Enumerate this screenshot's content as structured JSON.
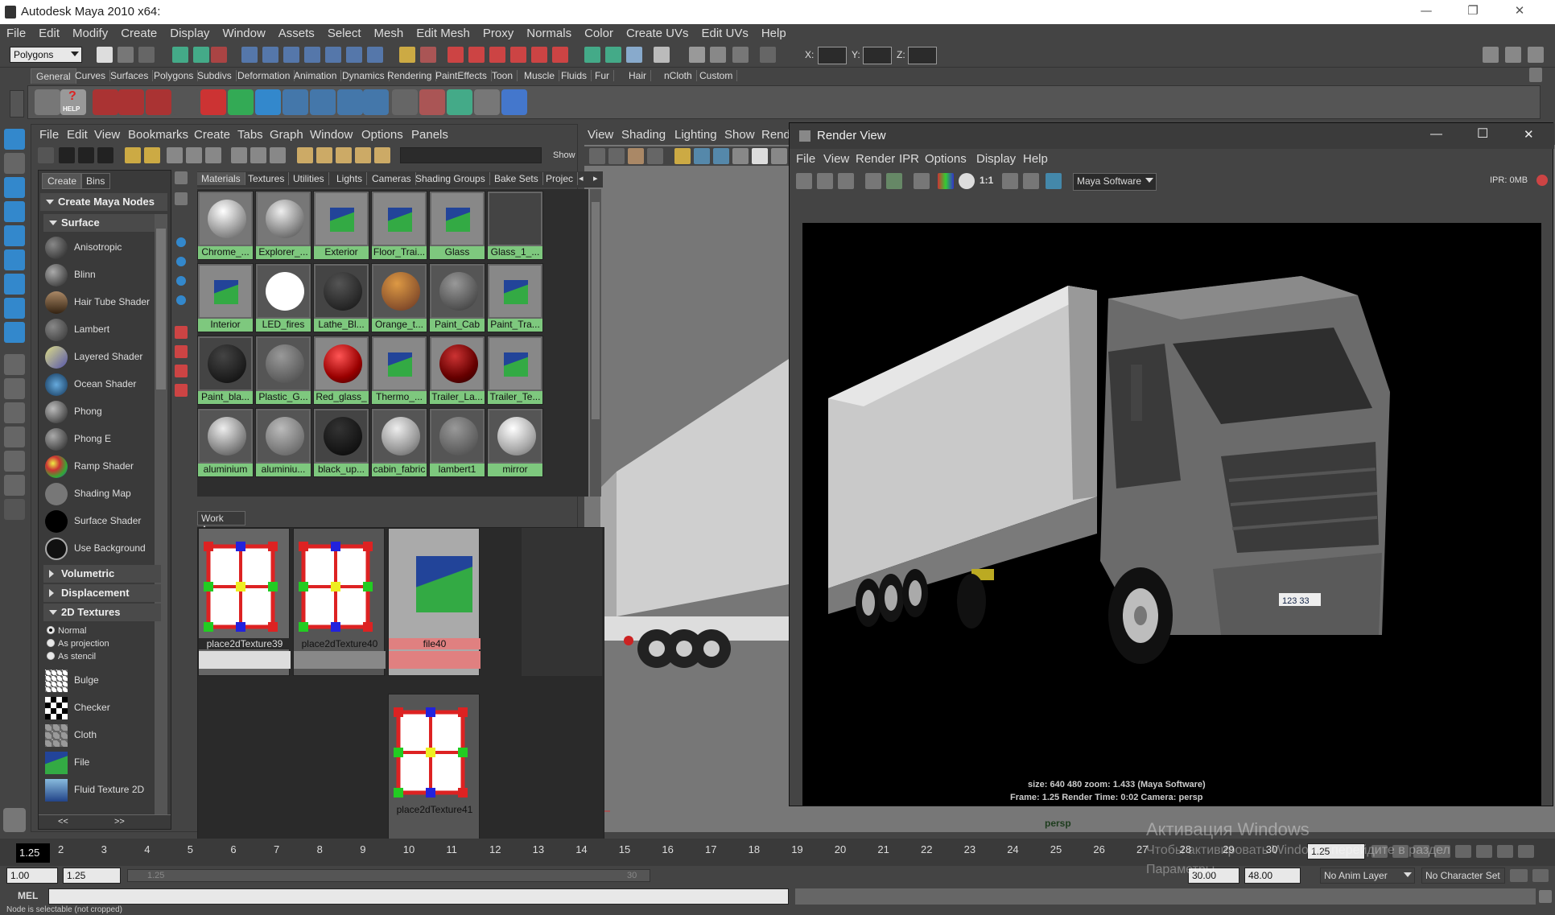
{
  "window": {
    "title": "Autodesk Maya 2010 x64:"
  },
  "menubar": [
    "File",
    "Edit",
    "Modify",
    "Create",
    "Display",
    "Window",
    "Assets",
    "Select",
    "Mesh",
    "Edit Mesh",
    "Proxy",
    "Normals",
    "Color",
    "Create UVs",
    "Edit UVs",
    "Help"
  ],
  "status": {
    "mode": "Polygons",
    "x_label": "X:",
    "y_label": "Y:",
    "z_label": "Z:"
  },
  "shelf_tabs": [
    "General",
    "Curves",
    "Surfaces",
    "Polygons",
    "Subdivs",
    "Deformation",
    "Animation",
    "Dynamics",
    "Rendering",
    "PaintEffects",
    "Toon",
    "Muscle",
    "Fluids",
    "Fur",
    "Hair",
    "nCloth",
    "Custom"
  ],
  "shelf": {
    "help_label": "HELP"
  },
  "hypershade": {
    "menu": [
      "File",
      "Edit",
      "View",
      "Bookmarks",
      "Create",
      "Tabs",
      "Graph",
      "Window",
      "Options",
      "Panels"
    ],
    "show_label": "Show",
    "left_tabs": [
      "Create",
      "Bins"
    ],
    "create_header": "Create Maya Nodes",
    "surface_header": "Surface",
    "surface_nodes": [
      "Anisotropic",
      "Blinn",
      "Hair Tube Shader",
      "Lambert",
      "Layered Shader",
      "Ocean Shader",
      "Phong",
      "Phong E",
      "Ramp Shader",
      "Shading Map",
      "Surface Shader",
      "Use Background"
    ],
    "volumetric_header": "Volumetric",
    "displacement_header": "Displacement",
    "textures2d_header": "2D Textures",
    "tex_modes": [
      "Normal",
      "As projection",
      "As stencil"
    ],
    "texture_nodes": [
      "Bulge",
      "Checker",
      "Cloth",
      "File",
      "Fluid Texture 2D"
    ],
    "tabs": [
      "Materials",
      "Textures",
      "Utilities",
      "Lights",
      "Cameras",
      "Shading Groups",
      "Bake Sets",
      "Projec"
    ],
    "materials": [
      "Chrome_...",
      "Explorer_...",
      "Exterior",
      "Floor_Trai...",
      "Glass",
      "Glass_1_...",
      "Interior",
      "LED_fires",
      "Lathe_Bl...",
      "Orange_t...",
      "Paint_Cab",
      "Paint_Tra...",
      "Paint_bla...",
      "Plastic_G...",
      "Red_glass_",
      "Thermo_...",
      "Trailer_La...",
      "Trailer_Te...",
      "aluminium",
      "aluminiu...",
      "black_up...",
      "cabin_fabric",
      "lambert1",
      "mirror"
    ],
    "work_area_label": "Work Area",
    "work_nodes": [
      "place2dTexture39",
      "place2dTexture40",
      "file40",
      "place2dTexture41"
    ]
  },
  "viewport": {
    "menu": [
      "View",
      "Shading",
      "Lighting",
      "Show",
      "Rend"
    ],
    "camera_label": "persp"
  },
  "render_view": {
    "title": "Render View",
    "menu": [
      "File",
      "View",
      "Render",
      "IPR",
      "Options",
      "Display",
      "Help"
    ],
    "ratio": "1:1",
    "renderer": "Maya Software",
    "ipr": "IPR: 0MB",
    "plate": "123 33",
    "info1": "size:  640  480 zoom: 1.433      (Maya Software)",
    "info2": "Frame: 1.25      Render Time: 0:02       Camera: persp"
  },
  "timeline": {
    "current": "1.25",
    "ticks": [
      "2",
      "3",
      "4",
      "5",
      "6",
      "7",
      "8",
      "9",
      "10",
      "11",
      "12",
      "13",
      "14",
      "15",
      "16",
      "17",
      "18",
      "19",
      "20",
      "21",
      "22",
      "23",
      "24",
      "25",
      "26",
      "27",
      "28",
      "29",
      "30"
    ],
    "current_field": "1.25"
  },
  "range": {
    "start": "1.00",
    "inner_start": "1.25",
    "inner_end_ghost": "30",
    "ghost_left": "1.25",
    "end": "30.00",
    "outer_end": "48.00",
    "anim_layer": "No Anim Layer",
    "char_set": "No Character Set"
  },
  "cmd": {
    "label": "MEL"
  },
  "help": {
    "text": "Node is selectable (not cropped)"
  },
  "watermark": {
    "line1": "Активация Windows",
    "line2": "Чтобы активировать Windows, перейдите в раздел",
    "line3": "Параметры."
  }
}
